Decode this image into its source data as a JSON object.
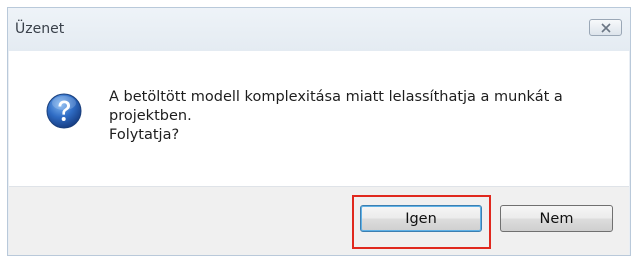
{
  "dialog": {
    "title": "Üzenet",
    "close_icon": "close-icon",
    "icon": "question-icon",
    "message_lines": [
      "A betöltött modell komplexitása miatt lelassíthatja a munkát a",
      "projektben.",
      "Folytatja?"
    ],
    "buttons": {
      "yes_label": "Igen",
      "no_label": "Nem"
    }
  },
  "colors": {
    "highlight": "#e0281e",
    "icon_blue": "#2a63b8",
    "titlebar": "#e9eef4"
  }
}
